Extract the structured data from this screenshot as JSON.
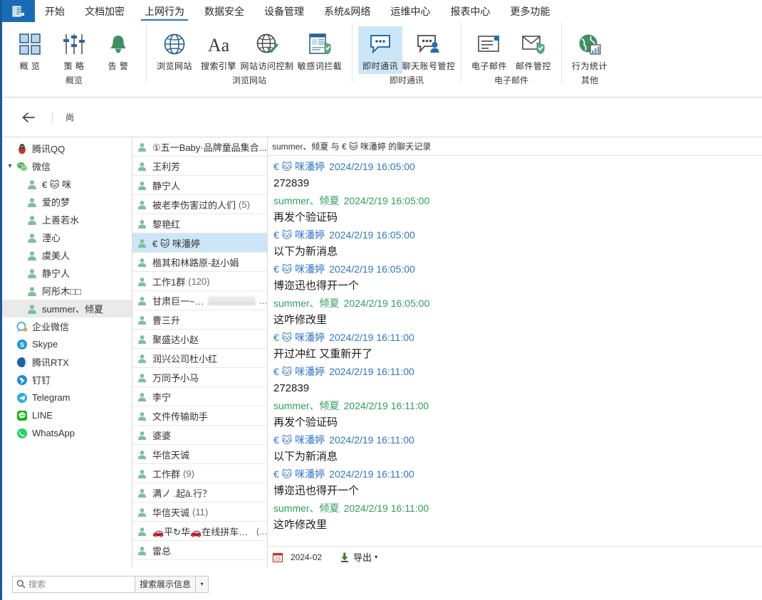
{
  "window": {
    "app_icon": "document-app-icon",
    "accent": "#1a6bb5",
    "border_color": "#1a5a96"
  },
  "ribbon": {
    "tabs": [
      {
        "label": "开始",
        "active": false
      },
      {
        "label": "文档加密",
        "active": false
      },
      {
        "label": "上网行为",
        "active": true
      },
      {
        "label": "数据安全",
        "active": false
      },
      {
        "label": "设备管理",
        "active": false
      },
      {
        "label": "系统&网络",
        "active": false
      },
      {
        "label": "运维中心",
        "active": false
      },
      {
        "label": "报表中心",
        "active": false
      },
      {
        "label": "更多功能",
        "active": false
      }
    ],
    "groups": [
      {
        "label": "概览",
        "items": [
          {
            "caption": "概 览",
            "icon": "grid-tiles-icon",
            "selected": false
          },
          {
            "caption": "策 略",
            "icon": "sliders-icon",
            "selected": false
          },
          {
            "caption": "告 警",
            "icon": "bell-icon",
            "selected": false
          }
        ]
      },
      {
        "label": "浏览网站",
        "items": [
          {
            "caption": "浏览网站",
            "icon": "globe-icon",
            "selected": false
          },
          {
            "caption": "搜索引擎",
            "icon": "text-aa-icon",
            "selected": false
          },
          {
            "caption": "网站访问控制",
            "icon": "globe-check-icon",
            "selected": false
          },
          {
            "caption": "敏感词拦截",
            "icon": "page-shield-icon",
            "selected": false
          }
        ]
      },
      {
        "label": "即时通讯",
        "items": [
          {
            "caption": "即时通讯",
            "icon": "chat-bubble-icon",
            "selected": true
          },
          {
            "caption": "聊天账号管控",
            "icon": "chat-user-icon",
            "selected": false
          }
        ]
      },
      {
        "label": "电子邮件",
        "items": [
          {
            "caption": "电子邮件",
            "icon": "mail-card-icon",
            "selected": false
          },
          {
            "caption": "邮件管控",
            "icon": "mail-shield-icon",
            "selected": false
          }
        ]
      },
      {
        "label": "其他",
        "items": [
          {
            "caption": "行为统计",
            "icon": "globe-stats-icon",
            "selected": false
          }
        ]
      }
    ]
  },
  "navbar": {
    "back_icon": "arrow-left-icon",
    "crumb": "尚"
  },
  "sidebar": {
    "items": [
      {
        "label": "腾讯QQ",
        "icon": "qq-penguin-icon",
        "level": 1,
        "twisty": "",
        "selected": false
      },
      {
        "label": "微信",
        "icon": "wechat-icon",
        "level": 1,
        "twisty": "v",
        "selected": false
      },
      {
        "label": "€ 🐱 咪",
        "icon": "contact-person-icon",
        "level": 2,
        "twisty": "",
        "selected": false
      },
      {
        "label": "爱的梦",
        "icon": "contact-person-icon",
        "level": 2,
        "twisty": "",
        "selected": false
      },
      {
        "label": "上善若水",
        "icon": "contact-person-icon",
        "level": 2,
        "twisty": "",
        "selected": false
      },
      {
        "label": "湮心",
        "icon": "contact-person-icon",
        "level": 2,
        "twisty": "",
        "selected": false
      },
      {
        "label": "虞美人",
        "icon": "contact-person-icon",
        "level": 2,
        "twisty": "",
        "selected": false
      },
      {
        "label": "静宁人",
        "icon": "contact-person-icon",
        "level": 2,
        "twisty": "",
        "selected": false
      },
      {
        "label": "阿彤木□□",
        "icon": "contact-person-icon",
        "level": 2,
        "twisty": "",
        "selected": false
      },
      {
        "label": "summer、倾夏",
        "icon": "contact-person-icon",
        "level": 2,
        "twisty": "",
        "selected": true
      },
      {
        "label": "企业微信",
        "icon": "wework-icon",
        "level": 1,
        "twisty": "",
        "selected": false
      },
      {
        "label": "Skype",
        "icon": "skype-icon",
        "level": 1,
        "twisty": "",
        "selected": false
      },
      {
        "label": "腾讯RTX",
        "icon": "rtx-icon",
        "level": 1,
        "twisty": "",
        "selected": false
      },
      {
        "label": "钉钉",
        "icon": "dingtalk-icon",
        "level": 1,
        "twisty": "",
        "selected": false
      },
      {
        "label": "Telegram",
        "icon": "telegram-icon",
        "level": 1,
        "twisty": "",
        "selected": false
      },
      {
        "label": "LINE",
        "icon": "line-icon",
        "level": 1,
        "twisty": "",
        "selected": false
      },
      {
        "label": "WhatsApp",
        "icon": "whatsapp-icon",
        "level": 1,
        "twisty": "",
        "selected": false
      }
    ]
  },
  "contacts": {
    "items": [
      {
        "label": "①五一Baby·品牌童品集合...",
        "count": "",
        "selected": false,
        "redacted": false
      },
      {
        "label": "王利芳",
        "count": "",
        "selected": false,
        "redacted": false
      },
      {
        "label": "静宁人",
        "count": "",
        "selected": false,
        "redacted": false
      },
      {
        "label": "被老李伤害过的人们",
        "count": "(5)",
        "selected": false,
        "redacted": false
      },
      {
        "label": "黎艳红",
        "count": "",
        "selected": false,
        "redacted": false
      },
      {
        "label": "€ 🐱 咪潘婷",
        "count": "",
        "selected": true,
        "redacted": false
      },
      {
        "label": "楷其和林路原-赵小娟",
        "count": "",
        "selected": false,
        "redacted": false
      },
      {
        "label": "工作1群",
        "count": "(120)",
        "selected": false,
        "redacted": false
      },
      {
        "label": "甘肃巨一~小爹",
        "count": "...",
        "selected": false,
        "redacted": true
      },
      {
        "label": "曹三升",
        "count": "",
        "selected": false,
        "redacted": false
      },
      {
        "label": "聚盛达小赵",
        "count": "",
        "selected": false,
        "redacted": false
      },
      {
        "label": "润兴公司杜小红",
        "count": "",
        "selected": false,
        "redacted": false
      },
      {
        "label": "万同予小马",
        "count": "",
        "selected": false,
        "redacted": false
      },
      {
        "label": "李宁",
        "count": "",
        "selected": false,
        "redacted": false
      },
      {
        "label": "文件传输助手",
        "count": "",
        "selected": false,
        "redacted": false
      },
      {
        "label": "婆婆",
        "count": "",
        "selected": false,
        "redacted": false
      },
      {
        "label": "华信天诚",
        "count": "",
        "selected": false,
        "redacted": false
      },
      {
        "label": "工作群",
        "count": "(9)",
        "selected": false,
        "redacted": false
      },
      {
        "label": "满ノ .起ā.行？",
        "count": "",
        "selected": false,
        "redacted": false
      },
      {
        "label": "华信天诚",
        "count": "(11)",
        "selected": false,
        "redacted": false
      },
      {
        "label": "🚗平↻华🚗在线拼车🚗群",
        "count": "(...",
        "selected": false,
        "redacted": false
      },
      {
        "label": "雷总",
        "count": "",
        "selected": false,
        "redacted": false
      }
    ]
  },
  "chat": {
    "header": "summer、倾夏 与 € 🐱 咪潘婷 的聊天记录",
    "them_name": "€ 🐱 咪潘婷",
    "me_name": "summer、倾夏",
    "them_color": "#2f76c7",
    "me_color": "#2f9e5e",
    "messages": [
      {
        "side": "them",
        "sender": "€ 🐱 咪潘婷",
        "time": "2024/2/19 16:05:00",
        "text": "272839"
      },
      {
        "side": "me",
        "sender": "summer、倾夏",
        "time": "2024/2/19 16:05:00",
        "text": "再发个验证码"
      },
      {
        "side": "them",
        "sender": "€ 🐱 咪潘婷",
        "time": "2024/2/19 16:05:00",
        "text": "以下为新消息"
      },
      {
        "side": "them",
        "sender": "€ 🐱 咪潘婷",
        "time": "2024/2/19 16:05:00",
        "text": "博迩迅也得开一个"
      },
      {
        "side": "me",
        "sender": "summer、倾夏",
        "time": "2024/2/19 16:05:00",
        "text": "这咋修改里"
      },
      {
        "side": "them",
        "sender": "€ 🐱 咪潘婷",
        "time": "2024/2/19 16:11:00",
        "text": "开过冲红 又重新开了"
      },
      {
        "side": "them",
        "sender": "€ 🐱 咪潘婷",
        "time": "2024/2/19 16:11:00",
        "text": "272839"
      },
      {
        "side": "me",
        "sender": "summer、倾夏",
        "time": "2024/2/19 16:11:00",
        "text": "再发个验证码"
      },
      {
        "side": "them",
        "sender": "€ 🐱 咪潘婷",
        "time": "2024/2/19 16:11:00",
        "text": "以下为新消息"
      },
      {
        "side": "them",
        "sender": "€ 🐱 咪潘婷",
        "time": "2024/2/19 16:11:00",
        "text": "博迩迅也得开一个"
      },
      {
        "side": "me",
        "sender": "summer、倾夏",
        "time": "2024/2/19 16:11:00",
        "text": "这咋修改里"
      }
    ],
    "footer": {
      "calendar_icon": "calendar-23-icon",
      "date": "2024-02",
      "export_icon": "download-icon",
      "export_label": "导出",
      "export_caret": "▾"
    }
  },
  "searchbar": {
    "search_icon": "search-icon",
    "placeholder": "搜索",
    "value": "",
    "kind_label": "搜索展示信息",
    "caret": "▾"
  }
}
